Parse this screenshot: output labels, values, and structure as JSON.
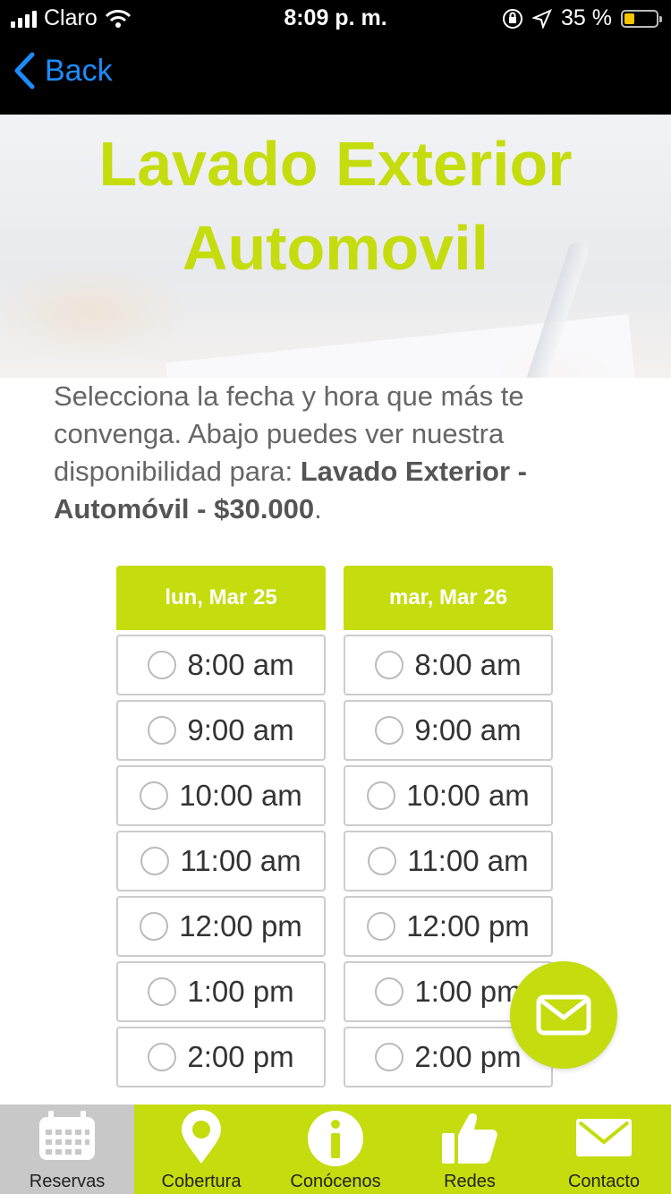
{
  "status": {
    "carrier": "Claro",
    "time": "8:09 p. m.",
    "battery": "35 %"
  },
  "nav": {
    "back_label": "Back"
  },
  "hero": {
    "title_line1": "Lavado Exterior",
    "title_line2": "Automovil"
  },
  "intro": {
    "text": "Selecciona la fecha y hora que más te convenga. Abajo puedes ver nuestra disponibilidad para: ",
    "service": "Lavado Exterior - Automóvil - $30.000",
    "end": "."
  },
  "schedule": {
    "days": [
      {
        "label": "lun, Mar 25",
        "slots": [
          "8:00 am",
          "9:00 am",
          "10:00 am",
          "11:00 am",
          "12:00 pm",
          "1:00 pm",
          "2:00 pm"
        ]
      },
      {
        "label": "mar, Mar 26",
        "slots": [
          "8:00 am",
          "9:00 am",
          "10:00 am",
          "11:00 am",
          "12:00 pm",
          "1:00 pm",
          "2:00 pm"
        ]
      }
    ]
  },
  "tabs": [
    {
      "label": "Reservas",
      "icon": "calendar-icon",
      "active": true
    },
    {
      "label": "Cobertura",
      "icon": "map-pin-icon",
      "active": false
    },
    {
      "label": "Conócenos",
      "icon": "info-icon",
      "active": false
    },
    {
      "label": "Redes",
      "icon": "thumbs-up-icon",
      "active": false
    },
    {
      "label": "Contacto",
      "icon": "mail-icon",
      "active": false
    }
  ],
  "colors": {
    "accent": "#c5dc0e",
    "link": "#1a8cff",
    "active_tab": "#c8c8c8"
  }
}
